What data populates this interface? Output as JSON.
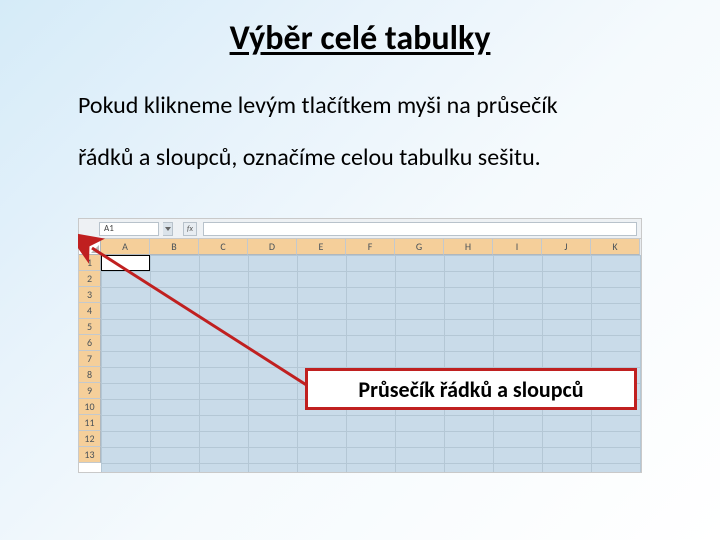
{
  "title": "Výběr celé tabulky",
  "paragraph_line1": "Pokud klikneme levým tlačítkem myši na průsečík",
  "paragraph_line2": "řádků a sloupců, označíme celou tabulku sešitu.",
  "callout_label": "Průsečík řádků a sloupců",
  "excel": {
    "namebox_value": "A1",
    "fx_label": "fx",
    "columns": [
      "A",
      "B",
      "C",
      "D",
      "E",
      "F",
      "G",
      "H",
      "I",
      "J",
      "K"
    ],
    "rows": [
      "1",
      "2",
      "3",
      "4",
      "5",
      "6",
      "7",
      "8",
      "9",
      "10",
      "11",
      "12",
      "13"
    ]
  }
}
